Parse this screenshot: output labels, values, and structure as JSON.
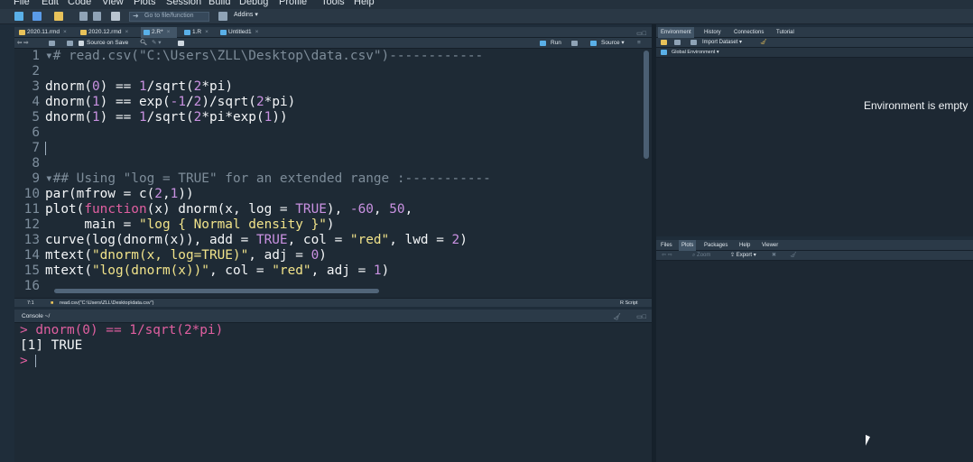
{
  "menu": [
    "File",
    "Edit",
    "Code",
    "View",
    "Plots",
    "Session",
    "Build",
    "Debug",
    "Profile",
    "Tools",
    "Help"
  ],
  "toolbar": {
    "goto_placeholder": "Go to file/function",
    "addins_label": "Addins"
  },
  "editor": {
    "tabs": [
      {
        "label": "2020.11.rmd"
      },
      {
        "label": "2020.12.rmd"
      },
      {
        "label": "2.R*"
      },
      {
        "label": "1.R"
      },
      {
        "label": "Untitled1"
      }
    ],
    "source_on_save": "Source on Save",
    "run_label": "Run",
    "source_label": "Source",
    "status_position": "7:1",
    "status_scope": "read.csv(\"C:\\Users\\ZLL\\Desktop\\data.csv\")",
    "status_lang": "R Script",
    "lines": [
      {
        "n": "1",
        "fold": true
      },
      {
        "n": "2"
      },
      {
        "n": "3"
      },
      {
        "n": "4"
      },
      {
        "n": "5"
      },
      {
        "n": "6"
      },
      {
        "n": "7"
      },
      {
        "n": "8"
      },
      {
        "n": "9",
        "fold": true
      },
      {
        "n": "10"
      },
      {
        "n": "11"
      },
      {
        "n": "12"
      },
      {
        "n": "13"
      },
      {
        "n": "14"
      },
      {
        "n": "15"
      },
      {
        "n": "16"
      }
    ],
    "code": {
      "l1": "# read.csv(\"C:\\Users\\ZLL\\Desktop\\data.csv\")------------",
      "l3a": "dnorm",
      "l3b": "(",
      "l3c": "0",
      "l3d": ") == ",
      "l3e": "1",
      "l3f": "/sqrt(",
      "l3g": "2",
      "l3h": "*pi)",
      "l4a": "dnorm",
      "l4b": "(",
      "l4c": "1",
      "l4d": ") == exp(",
      "l4e": "-1",
      "l4f": "/",
      "l4g": "2",
      "l4h": ")/sqrt(",
      "l4i": "2",
      "l4j": "*pi)",
      "l5a": "dnorm",
      "l5b": "(",
      "l5c": "1",
      "l5d": ") == ",
      "l5e": "1",
      "l5f": "/sqrt(",
      "l5g": "2",
      "l5h": "*pi*exp(",
      "l5i": "1",
      "l5j": "))",
      "l9": "## Using \"log = TRUE\" for an extended range :-----------",
      "l10a": "par(mfrow = c(",
      "l10b": "2",
      "l10c": ",",
      "l10d": "1",
      "l10e": "))",
      "l11a": "plot(",
      "l11b": "function",
      "l11c": "(x) dnorm(x, log = ",
      "l11d": "TRUE",
      "l11e": "), ",
      "l11f": "-60",
      "l11g": ", ",
      "l11h": "50",
      "l11i": ",",
      "l12a": "     main = ",
      "l12b": "\"log { Normal density }\"",
      "l12c": ")",
      "l13a": "curve(log(dnorm(x)), add = ",
      "l13b": "TRUE",
      "l13c": ", col = ",
      "l13d": "\"red\"",
      "l13e": ", lwd = ",
      "l13f": "2",
      "l13g": ")",
      "l14a": "mtext(",
      "l14b": "\"dnorm(x, log=TRUE)\"",
      "l14c": ", adj = ",
      "l14d": "0",
      "l14e": ")",
      "l15a": "mtext(",
      "l15b": "\"log(dnorm(x))\"",
      "l15c": ", col = ",
      "l15d": "\"red\"",
      "l15e": ", adj = ",
      "l15f": "1",
      "l15g": ")"
    }
  },
  "console": {
    "title": "Console ~/",
    "lines": [
      {
        "text": "> dnorm(0) == 1/sqrt(2*pi)"
      },
      {
        "text": "[1] TRUE"
      },
      {
        "text": "> "
      }
    ]
  },
  "environment": {
    "tabs": [
      "Environment",
      "History",
      "Connections",
      "Tutorial"
    ],
    "import_dataset": "Import Dataset",
    "scope": "Global Environment",
    "empty_message": "Environment is empty"
  },
  "files": {
    "tabs": [
      "Files",
      "Plots",
      "Packages",
      "Help",
      "Viewer"
    ],
    "zoom_label": "Zoom",
    "export_label": "Export"
  }
}
